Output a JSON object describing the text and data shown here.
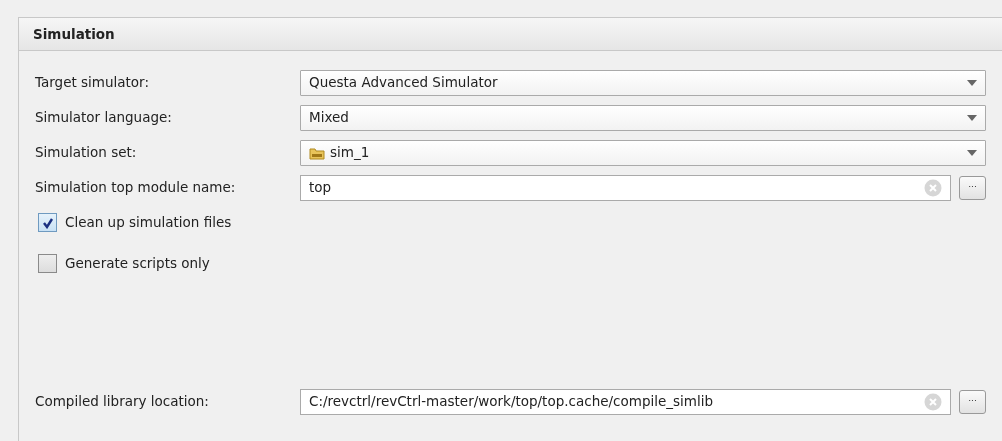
{
  "panel": {
    "title": "Simulation"
  },
  "fields": [
    {
      "kind": "dropdown",
      "label": "Target simulator:",
      "value": "Questa Advanced Simulator"
    },
    {
      "kind": "dropdown",
      "label": "Simulator language:",
      "value": "Mixed"
    },
    {
      "kind": "folder_dropdown",
      "label": "Simulation set:",
      "value": "sim_1"
    },
    {
      "kind": "text",
      "label": "Simulation top module name:",
      "value": "top",
      "browse": "..."
    }
  ],
  "options": [
    {
      "label": "Clean up simulation files",
      "checked": true
    },
    {
      "label": "Generate scripts only",
      "checked": false
    }
  ],
  "library": {
    "kind": "text",
    "label": "Compiled library location:",
    "value": "C:/revctrl/revCtrl-master/work/top/top.cache/compile_simlib",
    "browse": "..."
  }
}
